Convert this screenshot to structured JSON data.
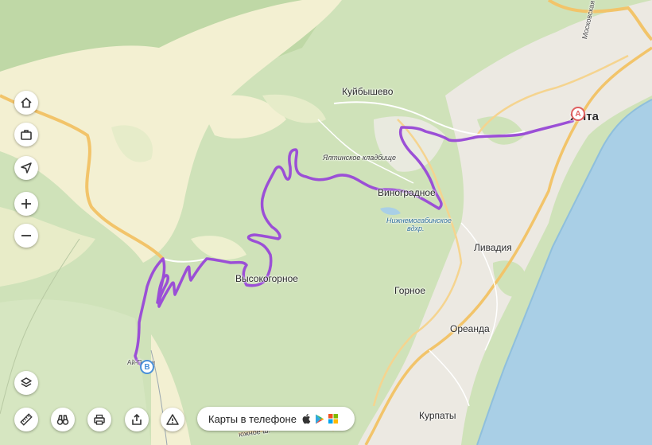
{
  "map": {
    "places": {
      "kuibyshevo": "Куйбышево",
      "cemetery": "Ялтинское кладбище",
      "vinogradnoe": "Виноградное",
      "reservoir_line1": "Нижнемогабинское",
      "reservoir_line2": "вдхр.",
      "livadia": "Ливадия",
      "vysokogornoe": "Высокогорное",
      "gornoe": "Горное",
      "oreanda": "Ореанда",
      "kurpaty": "Курпаты",
      "yalta": "Ялта",
      "ai_petri": "Ай-Петри",
      "moskovskaya": "Московская ул.",
      "street_bottom": "южное ш."
    },
    "route": {
      "color": "#9b4fd6",
      "start_marker": "A",
      "end_marker": "B"
    },
    "colors": {
      "forest": "#cfe2b9",
      "meadow": "#f3f0d2",
      "sea": "#a9cfe6",
      "road": "#f2c46a",
      "town": "#ece9e2"
    }
  },
  "controls": {
    "home": "home-icon",
    "briefcase": "briefcase-icon",
    "locate": "navigation-arrow-icon",
    "zoom_in": "plus-icon",
    "zoom_out": "minus-icon",
    "layers": "layers-icon",
    "ruler": "ruler-icon",
    "panorama": "binoculars-icon",
    "print": "printer-icon",
    "share": "share-icon",
    "report": "warning-icon"
  },
  "promo": {
    "label": "Карты в телефоне",
    "stores": [
      "apple-icon",
      "google-play-icon",
      "windows-icon"
    ]
  }
}
